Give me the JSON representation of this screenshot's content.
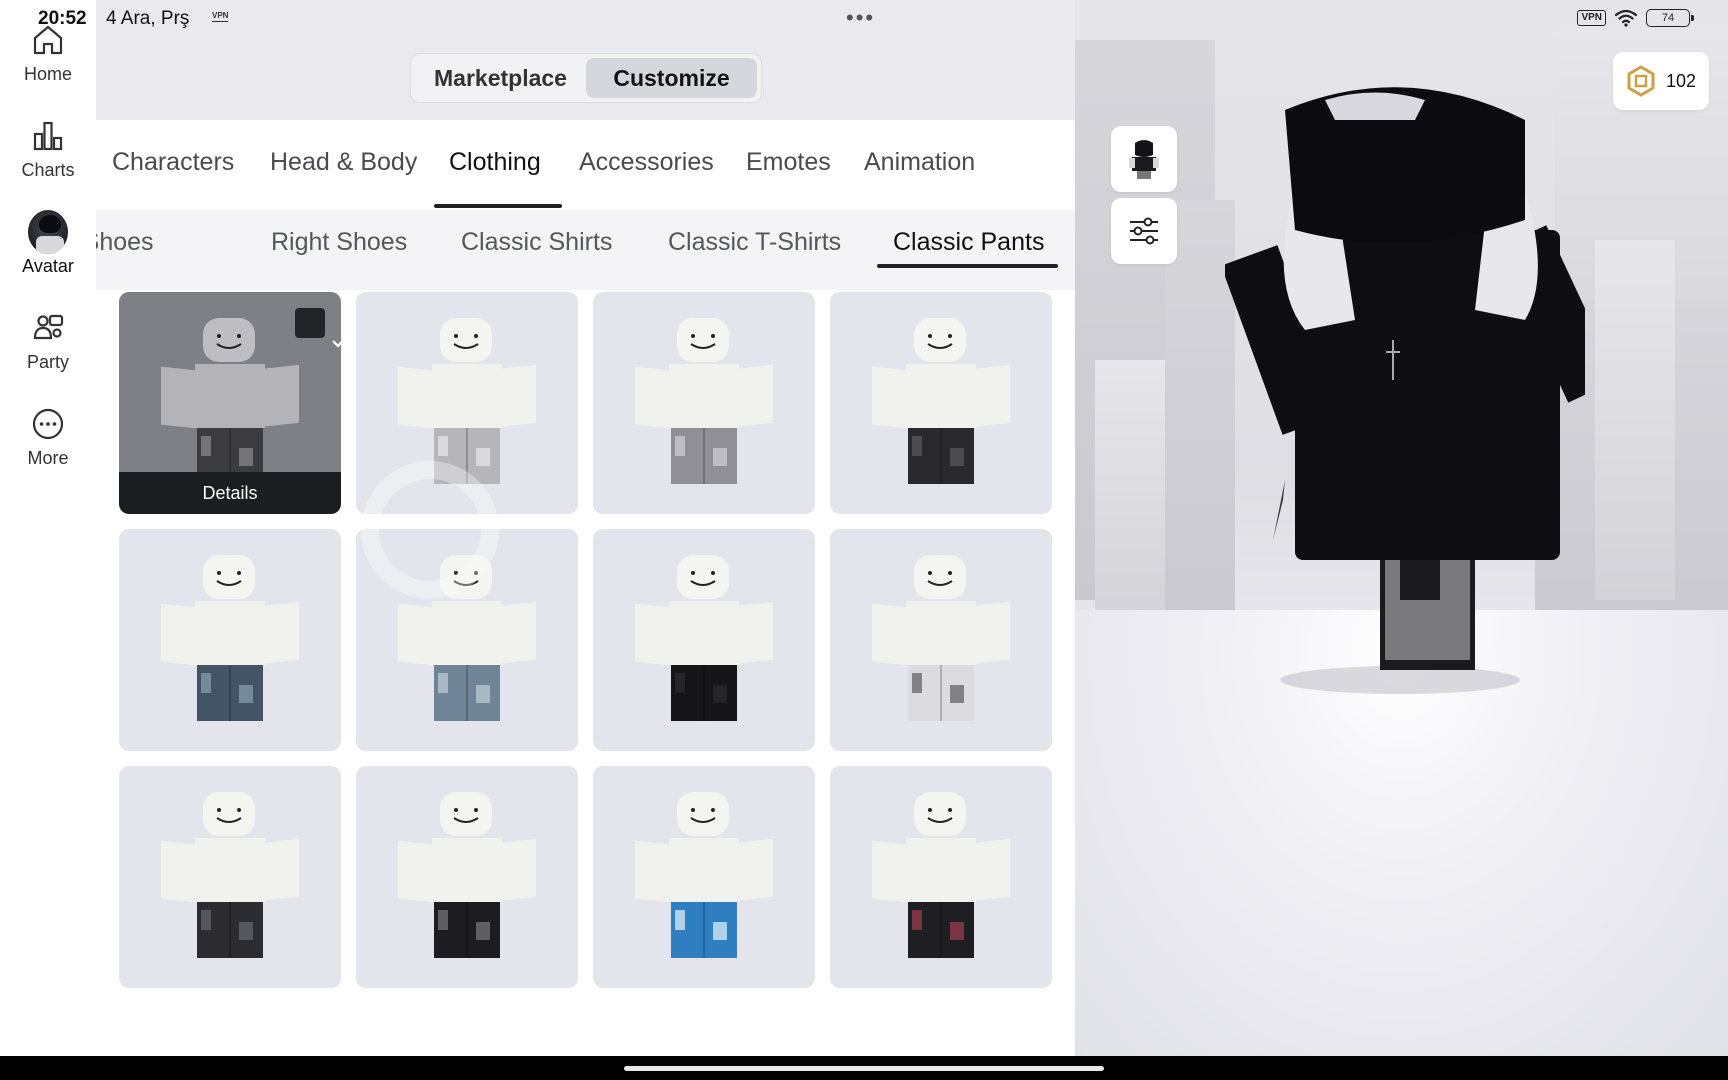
{
  "status_bar": {
    "time": "20:52",
    "date": "4 Ara, Prş",
    "vpn_small": "VPN",
    "vpn_badge": "VPN",
    "battery": "74"
  },
  "nav": {
    "items": [
      {
        "label": "Home",
        "icon": "home-icon"
      },
      {
        "label": "Charts",
        "icon": "charts-icon"
      },
      {
        "label": "Avatar",
        "icon": "avatar-thumbnail"
      },
      {
        "label": "Party",
        "icon": "party-icon"
      },
      {
        "label": "More",
        "icon": "more-icon"
      }
    ],
    "active": "Avatar"
  },
  "mode_toggle": {
    "marketplace": "Marketplace",
    "customize": "Customize",
    "active": "Customize"
  },
  "tabs": [
    "Characters",
    "Head & Body",
    "Clothing",
    "Accessories",
    "Emotes",
    "Animation"
  ],
  "active_tab": "Clothing",
  "subtabs": [
    "Left Shoes",
    "Right Shoes",
    "Classic Shirts",
    "Classic T-Shirts",
    "Classic Pants"
  ],
  "active_subtab": "Classic Pants",
  "grid": {
    "details_label": "Details",
    "items": [
      {
        "id": 1,
        "pants": "dark-patterned",
        "selected": true
      },
      {
        "id": 2,
        "pants": "plaid-grey",
        "selected": false
      },
      {
        "id": 3,
        "pants": "grey-chains",
        "selected": false
      },
      {
        "id": 4,
        "pants": "black-jeans",
        "selected": false
      },
      {
        "id": 5,
        "pants": "blue-denim",
        "selected": false
      },
      {
        "id": 6,
        "pants": "light-denim",
        "selected": false
      },
      {
        "id": 7,
        "pants": "solid-black",
        "selected": false
      },
      {
        "id": 8,
        "pants": "white-graphic",
        "selected": false
      },
      {
        "id": 9,
        "pants": "dark-cargo",
        "selected": false
      },
      {
        "id": 10,
        "pants": "black-distressed",
        "selected": false
      },
      {
        "id": 11,
        "pants": "blue-floral",
        "selected": false
      },
      {
        "id": 12,
        "pants": "black-red-print",
        "selected": false
      }
    ]
  },
  "robux": {
    "amount": "102",
    "icon": "robux-icon"
  },
  "colors": {
    "card_bg": "#e4e5ec",
    "selected_card_bg": "#7f7f86",
    "details_bar": "#1c1d21",
    "accent_underline": "#222222"
  }
}
